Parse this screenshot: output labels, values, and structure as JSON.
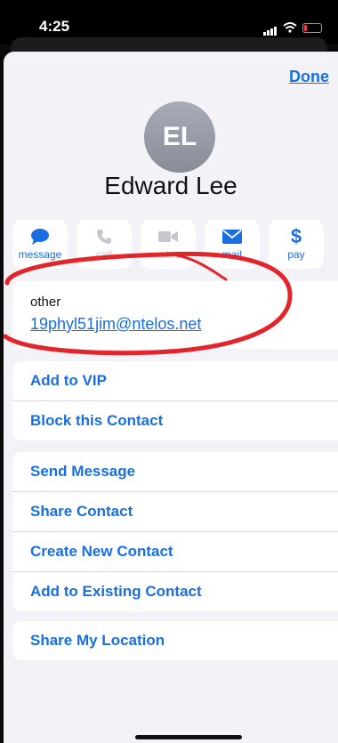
{
  "status": {
    "time": "4:25"
  },
  "header": {
    "done_label": "Done"
  },
  "contact": {
    "initials": "EL",
    "name": "Edward Lee"
  },
  "actions": [
    {
      "label": "message",
      "icon": "message-bubble-icon"
    },
    {
      "label": "call",
      "icon": "phone-icon"
    },
    {
      "label": "video",
      "icon": "video-camera-icon"
    },
    {
      "label": "mail",
      "icon": "envelope-icon"
    },
    {
      "label": "pay",
      "icon": "dollar-icon"
    }
  ],
  "email": {
    "label": "other",
    "value": "19phyl51jim@ntelos.net"
  },
  "group1": [
    "Add to VIP",
    "Block this Contact"
  ],
  "group2": [
    "Send Message",
    "Share Contact",
    "Create New Contact",
    "Add to Existing Contact"
  ],
  "group3": [
    "Share My Location"
  ],
  "colors": {
    "accent": "#1a6fe0",
    "annotation": "#e3242b",
    "disabled": "#c5c7cc"
  }
}
